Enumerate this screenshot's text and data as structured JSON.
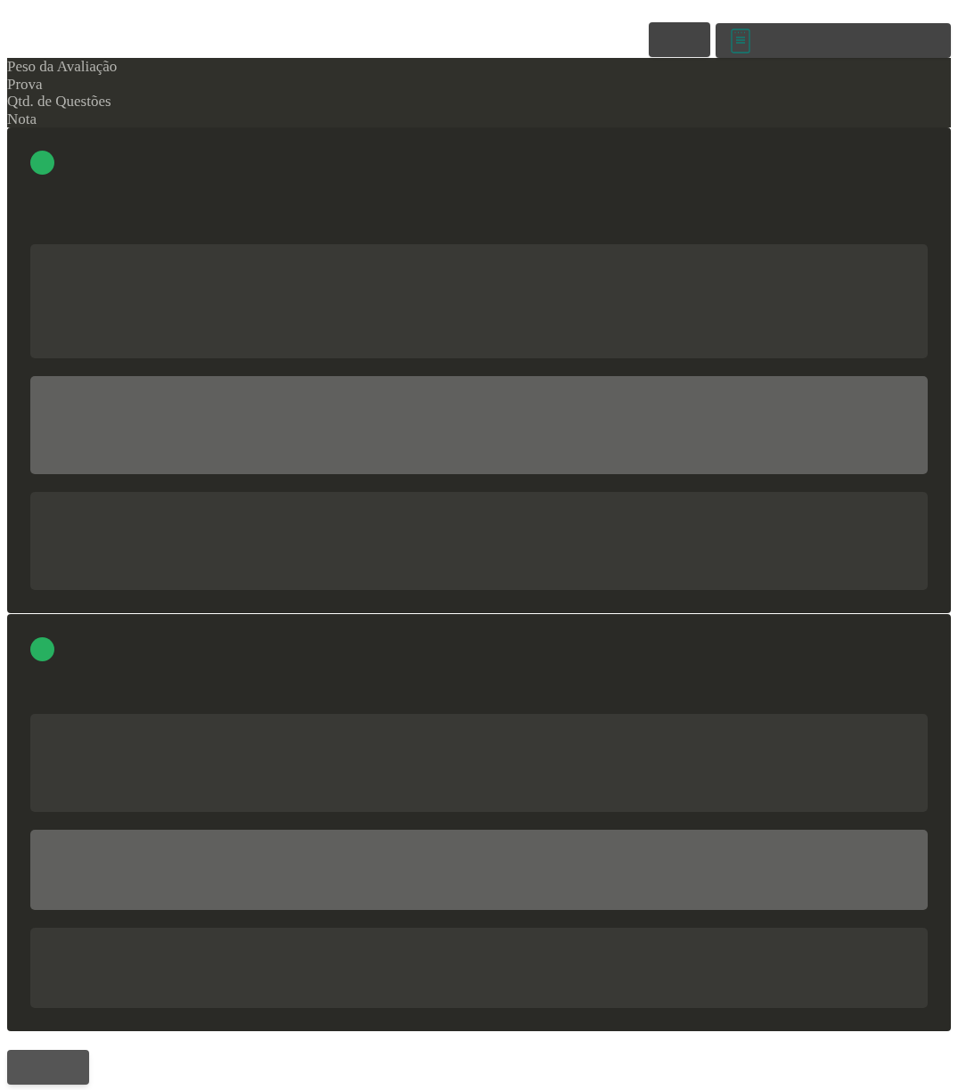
{
  "header": {
    "labels": [
      "Peso da Avaliação",
      "Prova",
      "Qtd. de Questões",
      "Nota"
    ]
  },
  "cards": [
    {
      "color": "#27b060",
      "rows": [
        {
          "selected": false
        },
        {
          "selected": true
        },
        {
          "selected": false
        }
      ]
    },
    {
      "color": "#27b060",
      "rows": [
        {
          "selected": false
        },
        {
          "selected": true
        },
        {
          "selected": false
        }
      ]
    }
  ]
}
